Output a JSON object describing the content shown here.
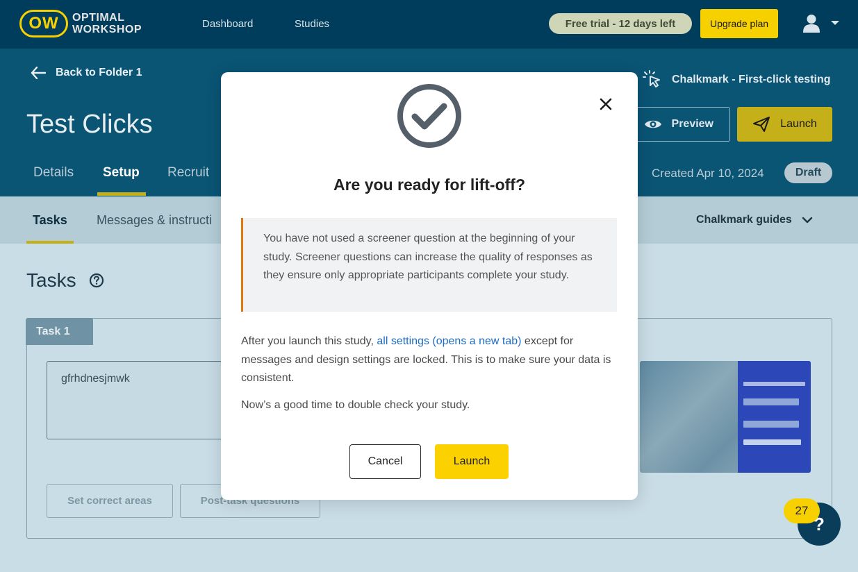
{
  "logo": {
    "badge": "OW",
    "line1": "OPTIMAL",
    "line2": "WORKSHOP"
  },
  "topnav": {
    "dashboard": "Dashboard",
    "studies": "Studies"
  },
  "trial": {
    "label": "Free trial - 12 days left"
  },
  "upgrade": {
    "label": "Upgrade plan"
  },
  "header": {
    "back_label": "Back to Folder 1",
    "title": "Test Clicks",
    "study_type": "Chalkmark - First-click testing",
    "preview_label": "Preview",
    "launch_label": "Launch",
    "tabs": [
      "Details",
      "Setup",
      "Recruit"
    ],
    "created": "Created Apr 10, 2024",
    "status": "Draft"
  },
  "subnav": {
    "tabs": [
      "Tasks",
      "Messages & instructi"
    ],
    "guides": "Chalkmark guides"
  },
  "tasks": {
    "heading": "Tasks",
    "task_tab": "Task 1",
    "task_text": "gfrhdnesjmwk",
    "set_areas": "Set correct areas",
    "post_task": "Post-task questions"
  },
  "help": {
    "badge": "27",
    "icon": "?"
  },
  "modal": {
    "title": "Are you ready for lift-off?",
    "notice": "You have not used a screener question at the beginning of your study. Screener questions can increase the quality of responses as they ensure only appropriate participants complete your study.",
    "para1_before": "After you launch this study, ",
    "para1_link": "all settings (opens a new tab)",
    "para1_after": " except for messages and design settings are locked. This is to make sure your data is consistent.",
    "para2": "Now’s a good time to double check your study.",
    "cancel": "Cancel",
    "launch": "Launch"
  },
  "colors": {
    "accent": "#fbd100",
    "notice_border": "#e2760e",
    "link": "#1f6cc4",
    "header_bg": "#003d5c"
  }
}
